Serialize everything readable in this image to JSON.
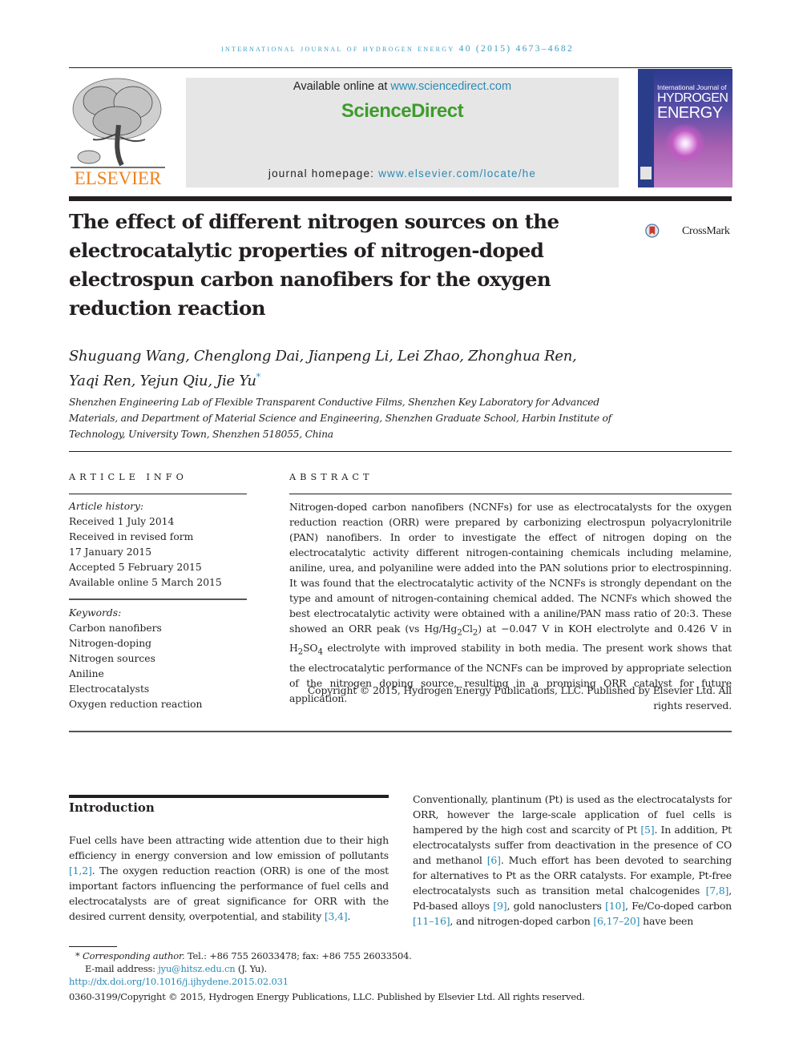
{
  "journal_header": "International Journal of Hydrogen Energy 40 (2015) 4673–4682",
  "publisher": {
    "logo_word": "ELSEVIER",
    "available_prefix": "Available online at ",
    "available_link": "www.sciencedirect.com",
    "brand": "ScienceDirect",
    "homepage_prefix": "journal homepage: ",
    "homepage_link": "www.elsevier.com/locate/he",
    "colors": {
      "elsevier": "#f07f1a",
      "sciencedirect": "#3e9c2c",
      "link": "#2a8bb5"
    }
  },
  "cover": {
    "line1": "International Journal of",
    "line2": "HYDROGEN",
    "line3": "ENERGY"
  },
  "crossmark_label": "CrossMark",
  "title": "The effect of different nitrogen sources on the electrocatalytic properties of nitrogen-doped electrospun carbon nanofibers for the oxygen reduction reaction",
  "authors_line1": "Shuguang Wang, Chenglong Dai, Jianpeng Li, Lei Zhao, Zhonghua Ren,",
  "authors_line2": "Yaqi Ren, Yejun Qiu, Jie Yu",
  "corresponding_mark": "*",
  "affiliation": "Shenzhen Engineering Lab of Flexible Transparent Conductive Films, Shenzhen Key Laboratory for Advanced Materials, and Department of Material Science and Engineering, Shenzhen Graduate School, Harbin Institute of Technology, University Town, Shenzhen 518055, China",
  "article_info": {
    "heading": "ARTICLE INFO",
    "history_label": "Article history:",
    "history": [
      "Received 1 July 2014",
      "Received in revised form",
      "17 January 2015",
      "Accepted 5 February 2015",
      "Available online 5 March 2015"
    ],
    "keywords_label": "Keywords:",
    "keywords": [
      "Carbon nanofibers",
      "Nitrogen-doping",
      "Nitrogen sources",
      "Aniline",
      "Electrocatalysts",
      "Oxygen reduction reaction"
    ]
  },
  "abstract": {
    "heading": "ABSTRACT",
    "part1": "Nitrogen-doped carbon nanofibers (NCNFs) for use as electrocatalysts for the oxygen reduction reaction (ORR) were prepared by carbonizing electrospun polyacrylonitrile (PAN) nanofibers. In order to investigate the effect of nitrogen doping on the electrocatalytic activity different nitrogen-containing chemicals including melamine, aniline, urea, and polyaniline were added into the PAN solutions prior to electrospinning. It was found that the electrocatalytic activity of the NCNFs is strongly dependant on the type and amount of nitrogen-containing chemical added. The NCNFs which showed the best electrocatalytic activity were obtained with a aniline/PAN mass ratio of 20:3. These showed an ORR peak (vs Hg/Hg",
    "sub1": "2",
    "part2": "Cl",
    "sub2": "2",
    "part3": ") at −0.047 V in KOH electrolyte and 0.426 V in H",
    "sub3": "2",
    "part4": "SO",
    "sub4": "4",
    "part5": " electrolyte with improved stability in both media. The present work shows that the electrocatalytic performance of the NCNFs can be improved by appropriate selection of the nitrogen doping source, resulting in a promising ORR catalyst for future application.",
    "copyright": "Copyright © 2015, Hydrogen Energy Publications, LLC. Published by Elsevier Ltd. All rights reserved."
  },
  "introduction": {
    "heading": "Introduction",
    "col1": {
      "t1": "Fuel cells have been attracting wide attention due to their high efficiency in energy conversion and low emission of pollutants ",
      "r1": "[1,2]",
      "t2": ". The oxygen reduction reaction (ORR) is one of the most important factors influencing the performance of fuel cells and electrocatalysts are of great significance for ORR with the desired current density, overpotential, and stability ",
      "r2": "[3,4]",
      "t3": "."
    },
    "col2": {
      "t1": "Conventionally, plantinum (Pt) is used as the electrocatalysts for ORR, however the large-scale application of fuel cells is hampered by the high cost and scarcity of Pt ",
      "r1": "[5]",
      "t2": ". In addition, Pt electrocatalysts suffer from deactivation in the presence of CO and methanol ",
      "r2": "[6]",
      "t3": ". Much effort has been devoted to searching for alternatives to Pt as the ORR catalysts. For example, Pt-free electrocatalysts such as transition metal chalcogenides ",
      "r3": "[7,8]",
      "t4": ", Pd-based alloys ",
      "r4": "[9]",
      "t5": ", gold nanoclusters ",
      "r5": "[10]",
      "t6": ", Fe/Co-doped carbon ",
      "r6": "[11–16]",
      "t7": ", and nitrogen-doped carbon ",
      "r7": "[6,17–20]",
      "t8": " have been"
    }
  },
  "footnotes": {
    "mark": "*",
    "corr_label": "Corresponding author.",
    "corr_text": " Tel.: +86 755 26033478; fax: +86 755 26033504.",
    "email_label": "E-mail address: ",
    "email": "jyu@hitsz.edu.cn",
    "email_suffix": " (J. Yu).",
    "doi": "http://dx.doi.org/10.1016/j.ijhydene.2015.02.031",
    "issn_copyright": "0360-3199/Copyright © 2015, Hydrogen Energy Publications, LLC. Published by Elsevier Ltd. All rights reserved."
  }
}
